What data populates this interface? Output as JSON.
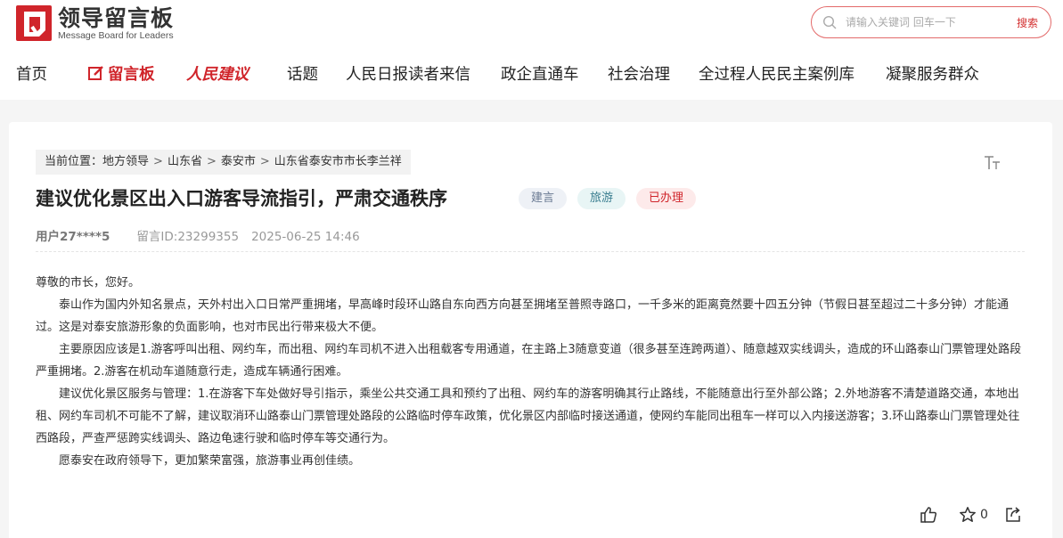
{
  "header": {
    "logo_title": "领导留言板",
    "logo_subtitle": "Message Board for Leaders"
  },
  "search": {
    "placeholder": "请输入关键词 回车一下",
    "button_label": "搜索"
  },
  "nav": {
    "items": [
      {
        "label": "首页"
      },
      {
        "label": "留言板"
      },
      {
        "label": "人民建议"
      },
      {
        "label": "话题"
      },
      {
        "label": "人民日报读者来信"
      },
      {
        "label": "政企直通车"
      },
      {
        "label": "社会治理"
      },
      {
        "label": "全过程人民民主案例库"
      },
      {
        "label": "凝聚服务群众"
      }
    ]
  },
  "breadcrumb": {
    "prefix": "当前位置：",
    "items": [
      "地方领导",
      "山东省",
      "泰安市",
      "山东省泰安市市长李兰祥"
    ],
    "separator": ">"
  },
  "message": {
    "title": "建议优化景区出入口游客导流指引，严肃交通秩序",
    "tags": [
      "建言",
      "旅游",
      "已办理"
    ],
    "user": "用户27****5",
    "message_id": "留言ID:23299355",
    "datetime": "2025-06-25 14:46",
    "paragraphs": [
      "尊敬的市长，您好。",
      "泰山作为国内外知名景点，天外村出入口日常严重拥堵，早高峰时段环山路自东向西方向甚至拥堵至普照寺路口，一千多米的距离竟然要十四五分钟（节假日甚至超过二十多分钟）才能通过。这是对泰安旅游形象的负面影响，也对市民出行带来极大不便。",
      "主要原因应该是1.游客呼叫出租、网约车，而出租、网约车司机不进入出租载客专用通道，在主路上3随意变道（很多甚至连跨两道）、随意越双实线调头，造成的环山路泰山门票管理处路段严重拥堵。2.游客在机动车道随意行走，造成车辆通行困难。",
      " 建议优化景区服务与管理：1.在游客下车处做好导引指示，乘坐公共交通工具和预约了出租、网约车的游客明确其行止路线，不能随意出行至外部公路；2.外地游客不清楚道路交通，本地出租、网约车司机不可能不了解，建议取消环山路泰山门票管理处路段的公路临时停车政策，优化景区内部临时接送通道，使网约车能同出租车一样可以入内接送游客；3.环山路泰山门票管理处往西路段，严查严惩跨实线调头、路边龟速行驶和临时停车等交通行为。",
      "愿泰安在政府领导下，更加繁荣富强，旅游事业再创佳绩。"
    ],
    "like_count": "0"
  },
  "colors": {
    "brand_red": "#d0252b",
    "search_border": "#e36a6a"
  },
  "icons": [
    "logo-mark",
    "search-icon",
    "edit-icon",
    "font-size-icon",
    "thumbs-up-icon",
    "star-icon",
    "share-icon"
  ]
}
